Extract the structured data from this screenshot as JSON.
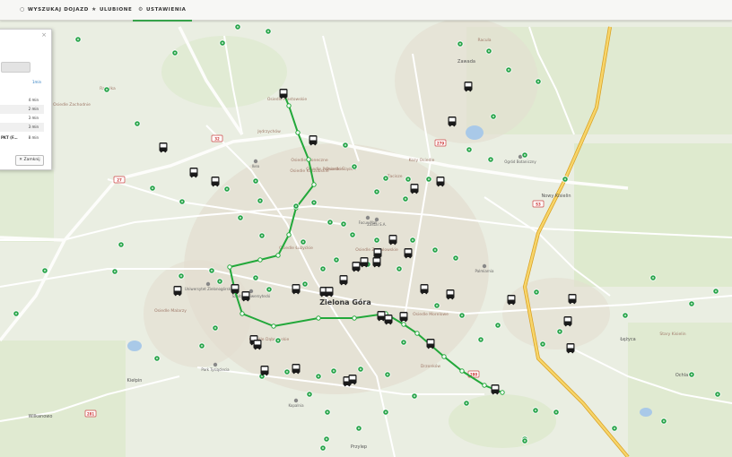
{
  "tabs": [
    {
      "label": "WYSZUKAJ DOJAZD",
      "icon": "○",
      "active": false
    },
    {
      "label": "ULUBIONE",
      "icon": "★",
      "active": false
    },
    {
      "label": "USTAWIENIA",
      "icon": "⚙",
      "active": true
    }
  ],
  "panel": {
    "close_glyph": "×",
    "link_label": "1min",
    "rows": [
      {
        "name": "",
        "time": "4 min"
      },
      {
        "name": "",
        "time": "2 min"
      },
      {
        "name": "",
        "time": "3 min"
      },
      {
        "name": "",
        "time": "3 min"
      },
      {
        "name": "PKT (F...",
        "time": "8 min"
      }
    ],
    "close_button_label": "Zamknij"
  },
  "map": {
    "city_label": "Zielona Góra",
    "district_labels": [
      "Osiedle Zachodnie",
      "Raculka",
      "Osiedle Piastowskie",
      "Jędrzychów",
      "Osiedle Słoneczne",
      "Osiedle Kaszubskie",
      "Osiedle Pomorskie",
      "Osiedle Śląskie",
      "Zacisze",
      "Osiedle Łużyckie",
      "Osiedle Malarzy",
      "Osiedle Dąbrowskie",
      "Osiedle Zastalowskie",
      "Kozy Osiedle",
      "Osiedle Morelowe",
      "Stary Kisielin",
      "Drzonków",
      "Racula"
    ],
    "poi_labels": [
      "Ikea",
      "Focus Mall",
      "Palmiarnia",
      "Uniwersytet Zielonogórski",
      "Szpital Uniwersytecki",
      "Park Tysiąclecia",
      "Kopalnia",
      "Ogród Botaniczny",
      "Zastal S.A."
    ],
    "road_labels": [
      "S3",
      "27",
      "32",
      "279",
      "281",
      "280"
    ],
    "locality_labels": [
      "Wilkanowo",
      "Kiełpin",
      "Zawada",
      "Łężyca",
      "Nowy Kisielin",
      "Przylep",
      "Ochla"
    ],
    "route_color": "#22a83a",
    "stop_color": "#2aa54b",
    "road_color": "#ffffff",
    "highway_color": "#f0b429"
  }
}
